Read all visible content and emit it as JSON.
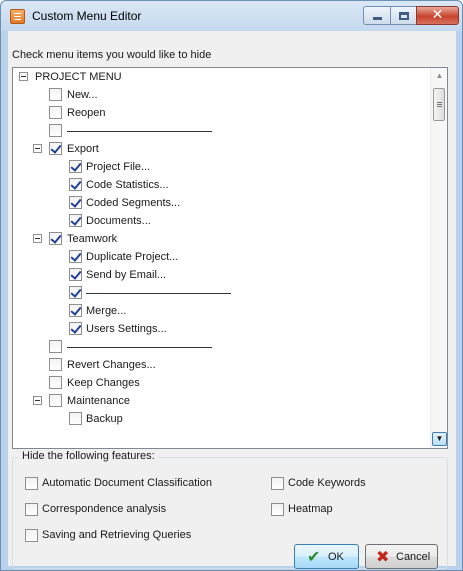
{
  "window": {
    "title": "Custom Menu Editor",
    "close_glyph": "✕"
  },
  "instruction": "Check menu items you would like to hide",
  "tree": [
    {
      "label": "PROJECT MENU",
      "level": 0,
      "expander": true,
      "checkbox": false,
      "checked": false
    },
    {
      "label": "New...",
      "level": 1,
      "checkbox": true,
      "checked": false
    },
    {
      "label": "Reopen",
      "level": 1,
      "checkbox": true,
      "checked": false
    },
    {
      "label": "",
      "level": 1,
      "checkbox": true,
      "checked": false,
      "separator": true
    },
    {
      "label": "Export",
      "level": 1,
      "expander": true,
      "checkbox": true,
      "checked": true
    },
    {
      "label": "Project File...",
      "level": 2,
      "checkbox": true,
      "checked": true
    },
    {
      "label": "Code Statistics...",
      "level": 2,
      "checkbox": true,
      "checked": true
    },
    {
      "label": "Coded Segments...",
      "level": 2,
      "checkbox": true,
      "checked": true
    },
    {
      "label": "Documents...",
      "level": 2,
      "checkbox": true,
      "checked": true
    },
    {
      "label": "Teamwork",
      "level": 1,
      "expander": true,
      "checkbox": true,
      "checked": true
    },
    {
      "label": "Duplicate Project...",
      "level": 2,
      "checkbox": true,
      "checked": true
    },
    {
      "label": "Send by Email...",
      "level": 2,
      "checkbox": true,
      "checked": true
    },
    {
      "label": "",
      "level": 2,
      "checkbox": true,
      "checked": true,
      "separator": true
    },
    {
      "label": "Merge...",
      "level": 2,
      "checkbox": true,
      "checked": true
    },
    {
      "label": "Users Settings...",
      "level": 2,
      "checkbox": true,
      "checked": true
    },
    {
      "label": "",
      "level": 1,
      "checkbox": true,
      "checked": false,
      "separator": true
    },
    {
      "label": "Revert Changes...",
      "level": 1,
      "checkbox": true,
      "checked": false
    },
    {
      "label": "Keep Changes",
      "level": 1,
      "checkbox": true,
      "checked": false
    },
    {
      "label": "Maintenance",
      "level": 1,
      "expander": true,
      "checkbox": true,
      "checked": false
    },
    {
      "label": "Backup",
      "level": 2,
      "checkbox": true,
      "checked": false
    }
  ],
  "features": {
    "title": "Hide the following features:",
    "items": [
      {
        "label": "Automatic Document Classification",
        "checked": false
      },
      {
        "label": "Code Keywords",
        "checked": false
      },
      {
        "label": "Correspondence analysis",
        "checked": false
      },
      {
        "label": "Heatmap",
        "checked": false
      },
      {
        "label": "Saving and Retrieving Queries",
        "checked": false
      }
    ]
  },
  "buttons": {
    "ok_label": "OK",
    "ok_icon": "✔",
    "ok_color": "#2e8b2e",
    "cancel_label": "Cancel",
    "cancel_icon": "✖",
    "cancel_color": "#c0281e"
  }
}
